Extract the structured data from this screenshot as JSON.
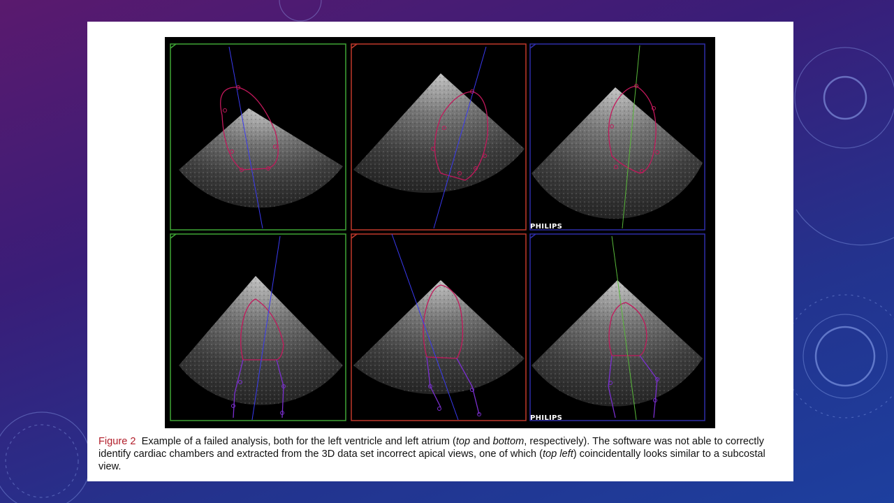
{
  "figure": {
    "brand_top": "PHILIPS",
    "brand_bottom": "PHILIPS",
    "panels": [
      {
        "row": "top",
        "col": 1,
        "frame_color": "#3fa535"
      },
      {
        "row": "top",
        "col": 2,
        "frame_color": "#c0392b"
      },
      {
        "row": "top",
        "col": 3,
        "frame_color": "#2e2ea8"
      },
      {
        "row": "bottom",
        "col": 1,
        "frame_color": "#3fa535"
      },
      {
        "row": "bottom",
        "col": 2,
        "frame_color": "#c0392b"
      },
      {
        "row": "bottom",
        "col": 3,
        "frame_color": "#2e2ea8"
      }
    ],
    "contour_colors": {
      "ventricle": "#c2185b",
      "atrium": "#7b2fd0",
      "axis_blue": "#3a3af0",
      "axis_green": "#58b83a"
    }
  },
  "caption": {
    "label": "Figure 2",
    "seg1": "Example of a failed analysis, both for the left ventricle and left atrium (",
    "italic1": "top",
    "seg2": " and ",
    "italic2": "bottom",
    "seg3": ", respectively). The software was not able to correctly identify cardiac chambers and extracted from the 3D data set incorrect apical views, one of which (",
    "italic3": "top left",
    "seg4": ") coincidentally looks similar to a subcostal view."
  }
}
